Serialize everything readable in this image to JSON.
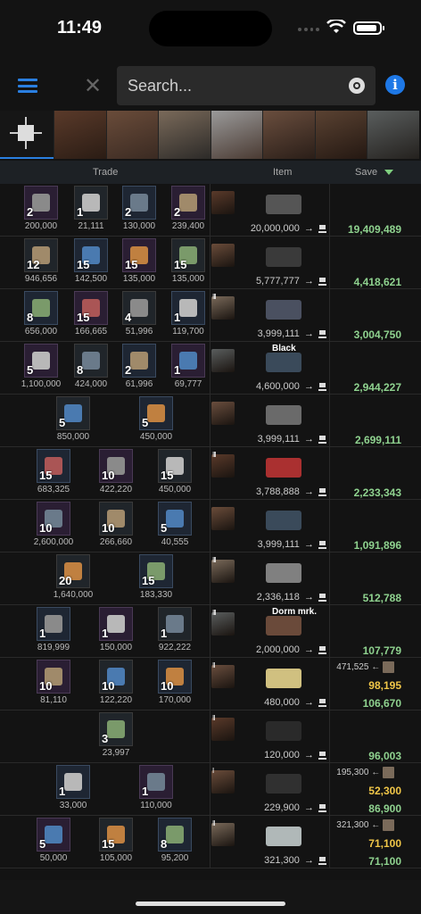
{
  "status_bar": {
    "time": "11:49"
  },
  "search": {
    "placeholder": "Search..."
  },
  "header": {
    "trade": "Trade",
    "item": "Item",
    "save": "Save"
  },
  "rows": [
    {
      "trade": [
        {
          "q": "2",
          "p": "200,000"
        },
        {
          "q": "1",
          "p": "21,111"
        },
        {
          "q": "2",
          "p": "130,000"
        },
        {
          "q": "2",
          "p": "239,400"
        }
      ],
      "level": "",
      "item_label": "",
      "item_price": "20,000,000",
      "save": "19,409,489"
    },
    {
      "trade": [
        {
          "q": "12",
          "p": "946,656"
        },
        {
          "q": "15",
          "p": "142,500"
        },
        {
          "q": "15",
          "p": "135,000"
        },
        {
          "q": "15",
          "p": "135,000"
        }
      ],
      "level": "",
      "item_label": "",
      "item_price": "5,777,777",
      "save": "4,418,621"
    },
    {
      "trade": [
        {
          "q": "8",
          "p": "656,000"
        },
        {
          "q": "15",
          "p": "166,665"
        },
        {
          "q": "4",
          "p": "51,996"
        },
        {
          "q": "1",
          "p": "119,700"
        }
      ],
      "level": "III",
      "item_label": "",
      "item_price": "3,999,111",
      "save": "3,004,750"
    },
    {
      "trade": [
        {
          "q": "5",
          "p": "1,100,000"
        },
        {
          "q": "8",
          "p": "424,000"
        },
        {
          "q": "2",
          "p": "61,996"
        },
        {
          "q": "1",
          "p": "69,777"
        }
      ],
      "level": "",
      "item_label": "Black",
      "item_price": "4,600,000",
      "save": "2,944,227"
    },
    {
      "trade": [
        {
          "q": "5",
          "p": "850,000"
        },
        {
          "q": "5",
          "p": "450,000"
        }
      ],
      "level": "",
      "item_label": "",
      "item_price": "3,999,111",
      "save": "2,699,111"
    },
    {
      "trade": [
        {
          "q": "15",
          "p": "683,325"
        },
        {
          "q": "10",
          "p": "422,220"
        },
        {
          "q": "15",
          "p": "450,000"
        }
      ],
      "level": "III",
      "item_label": "",
      "item_price": "3,788,888",
      "save": "2,233,343"
    },
    {
      "trade": [
        {
          "q": "10",
          "p": "2,600,000"
        },
        {
          "q": "10",
          "p": "266,660"
        },
        {
          "q": "5",
          "p": "40,555"
        }
      ],
      "level": "",
      "item_label": "",
      "item_price": "3,999,111",
      "save": "1,091,896"
    },
    {
      "trade": [
        {
          "q": "20",
          "p": "1,640,000"
        },
        {
          "q": "15",
          "p": "183,330"
        }
      ],
      "level": "III",
      "item_label": "",
      "item_price": "2,336,118",
      "save": "512,788"
    },
    {
      "trade": [
        {
          "q": "1",
          "p": "819,999"
        },
        {
          "q": "1",
          "p": "150,000"
        },
        {
          "q": "1",
          "p": "922,222"
        }
      ],
      "level": "III",
      "item_label": "Dorm mrk.",
      "item_price": "2,000,000",
      "save": "107,779"
    },
    {
      "trade": [
        {
          "q": "10",
          "p": "81,110"
        },
        {
          "q": "10",
          "p": "122,220"
        },
        {
          "q": "10",
          "p": "170,000"
        }
      ],
      "level": "II",
      "item_label": "",
      "item_price": "480,000",
      "save_alt_price": "471,525",
      "save_alt": "98,195",
      "save": "106,670"
    },
    {
      "trade": [
        {
          "q": "3",
          "p": "23,997"
        }
      ],
      "level": "II",
      "item_label": "",
      "item_price": "120,000",
      "save": "96,003"
    },
    {
      "trade": [
        {
          "q": "1",
          "p": "33,000"
        },
        {
          "q": "1",
          "p": "110,000"
        }
      ],
      "level": "I",
      "item_label": "",
      "item_price": "229,900",
      "save_alt_price": "195,300",
      "save_alt": "52,300",
      "save": "86,900"
    },
    {
      "trade": [
        {
          "q": "5",
          "p": "50,000"
        },
        {
          "q": "15",
          "p": "105,000"
        },
        {
          "q": "8",
          "p": "95,200"
        }
      ],
      "level": "II",
      "item_label": "",
      "item_price": "321,300",
      "save_alt_price": "321,300",
      "save_alt": "71,100",
      "save": "71,100"
    }
  ]
}
